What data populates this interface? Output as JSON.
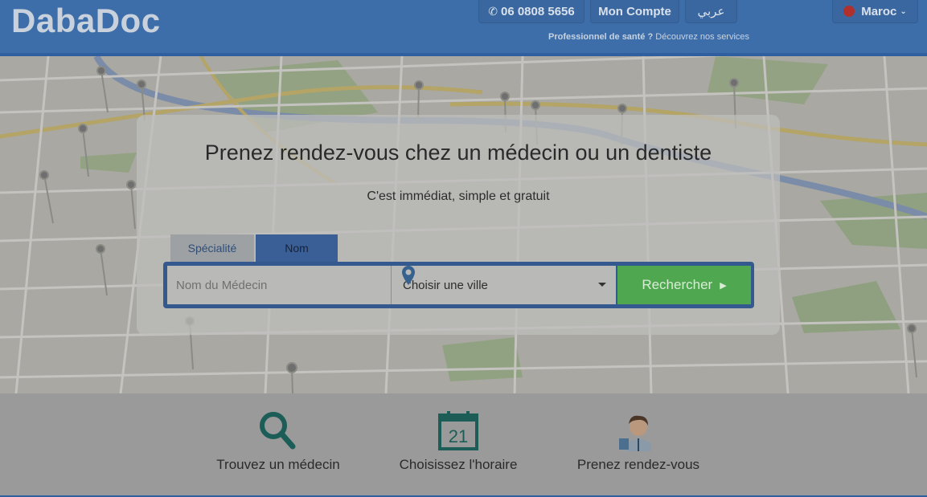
{
  "header": {
    "logo": "DabaDoc",
    "phone": "06 0808 5656",
    "account": "Mon Compte",
    "arabic": "عربي",
    "country": "Maroc",
    "pro_bold": "Professionnel de santé ?",
    "pro_link": "Découvrez nos services"
  },
  "hero": {
    "title": "Prenez rendez-vous chez un médecin ou un dentiste",
    "subtitle": "C'est immédiat, simple et gratuit"
  },
  "search": {
    "tabs": [
      "Spécialité",
      "Nom"
    ],
    "active_tab": "Nom",
    "name_placeholder": "Nom du Médecin",
    "city_value": "Choisir une ville",
    "button": "Rechercher"
  },
  "steps": [
    {
      "label": "Trouvez un médecin",
      "icon": "search-icon"
    },
    {
      "label": "Choisissez l'horaire",
      "icon": "calendar-icon",
      "day": "21"
    },
    {
      "label": "Prenez rendez-vous",
      "icon": "doctor-icon"
    }
  ],
  "colors": {
    "header": "#3d6eaa",
    "accent_green": "#4fa84f",
    "icon_teal": "#1c5e57"
  }
}
